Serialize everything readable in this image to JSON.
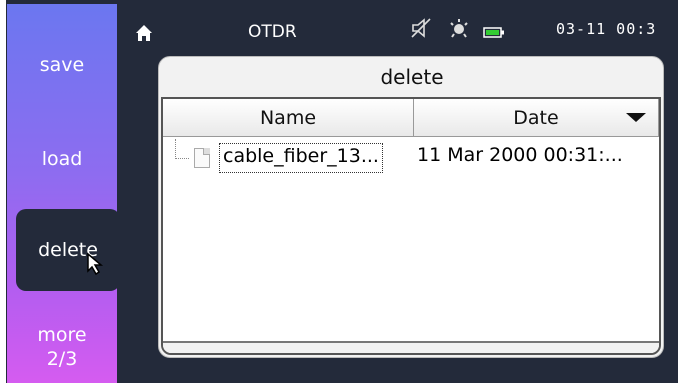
{
  "header": {
    "title": "OTDR",
    "clock": "03-11 00:3"
  },
  "sidebar": {
    "items": [
      {
        "label": "save"
      },
      {
        "label": "load"
      },
      {
        "label": "delete",
        "selected": true
      },
      {
        "label": "more",
        "page": "2/3"
      }
    ]
  },
  "dialog": {
    "title": "delete",
    "columns": [
      "Name",
      "Date"
    ],
    "sort_column": "Date",
    "rows": [
      {
        "name": "cable_fiber_13...",
        "date": "11 Mar 2000 00:31:..."
      }
    ]
  },
  "icons": {
    "home": "home-icon",
    "mute": "speaker-mute-icon",
    "brightness": "brightness-icon",
    "battery": "battery-icon"
  },
  "colors": {
    "background": "#232a3a",
    "sidebar_top": "#6b77f0",
    "sidebar_bottom": "#d55cf0",
    "battery": "#33cc33"
  }
}
